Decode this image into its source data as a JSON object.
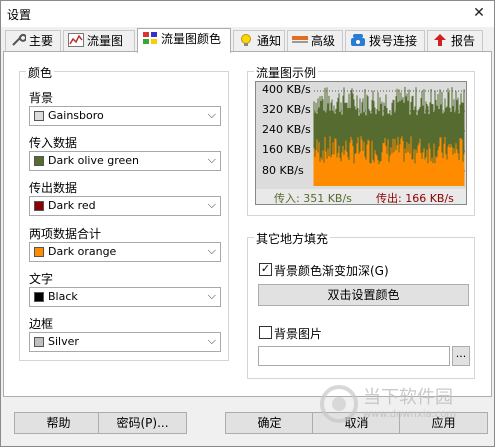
{
  "window": {
    "title": "设置",
    "close_glyph": "✕"
  },
  "tabs": [
    {
      "label": "主要",
      "icon": "wrench-icon"
    },
    {
      "label": "流量图",
      "icon": "line-chart-icon"
    },
    {
      "label": "流量图颜色",
      "icon": "palette-icon"
    },
    {
      "label": "通知",
      "icon": "lightbulb-icon"
    },
    {
      "label": "高级",
      "icon": "bar-icon"
    },
    {
      "label": "拨号连接",
      "icon": "phone-icon"
    },
    {
      "label": "报告",
      "icon": "upload-icon"
    }
  ],
  "colors_group": {
    "title": "颜色",
    "items": [
      {
        "label": "背景",
        "value": "Gainsboro",
        "swatch": "#dcdcdc"
      },
      {
        "label": "传入数据",
        "value": "Dark olive green",
        "swatch": "#556b2f"
      },
      {
        "label": "传出数据",
        "value": "Dark red",
        "swatch": "#8b0000"
      },
      {
        "label": "两项数据合计",
        "value": "Dark orange",
        "swatch": "#ff8c00"
      },
      {
        "label": "文字",
        "value": "Black",
        "swatch": "#000000"
      },
      {
        "label": "边框",
        "value": "Silver",
        "swatch": "#c0c0c0"
      }
    ]
  },
  "preview": {
    "title": "流量图示例",
    "ticks": [
      "400 KB/s",
      "320 KB/s",
      "240 KB/s",
      "160 KB/s",
      "80 KB/s"
    ],
    "in_text": "传入: 351 KB/s",
    "out_text": "传出: 166 KB/s",
    "in_color": "#556b2f",
    "out_color": "#ff8c00"
  },
  "other_fill": {
    "title": "其它地方填充",
    "gradient_label": "背景颜色渐变加深(G)",
    "gradient_checked": true,
    "set_color_button": "双击设置颜色",
    "bg_image_label": "背景图片",
    "bg_image_checked": false,
    "path_value": "",
    "browse_button": "..."
  },
  "footer": {
    "help": "帮助",
    "password": "密码(P)...",
    "ok": "确定",
    "cancel": "取消",
    "apply": "应用"
  },
  "watermark": {
    "text": "当下软件园",
    "url": "www.downxia.com"
  }
}
